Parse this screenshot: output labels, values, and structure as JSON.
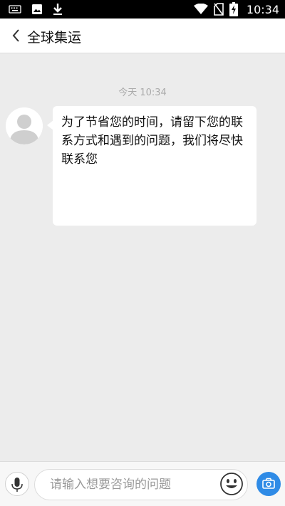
{
  "status_bar": {
    "time": "10:34",
    "icons": [
      "keyboard-icon",
      "image-icon",
      "download-icon",
      "wifi-icon",
      "no-sim-icon",
      "battery-charging-icon"
    ]
  },
  "header": {
    "title": "全球集运",
    "back_icon": "chevron-left-icon"
  },
  "chat": {
    "timestamp": "今天 10:34",
    "messages": [
      {
        "sender_icon": "default-avatar-icon",
        "text": "为了节省您的时间，请留下您的联系方式和遇到的问题，我们将尽快联系您"
      }
    ]
  },
  "input_bar": {
    "placeholder": "请输入想要咨询的问题",
    "value": "",
    "icons": [
      "microphone-icon",
      "emoji-icon",
      "camera-icon"
    ]
  },
  "colors": {
    "accent": "#2f8be6",
    "chat_background": "#ececec",
    "bubble": "#ffffff"
  }
}
